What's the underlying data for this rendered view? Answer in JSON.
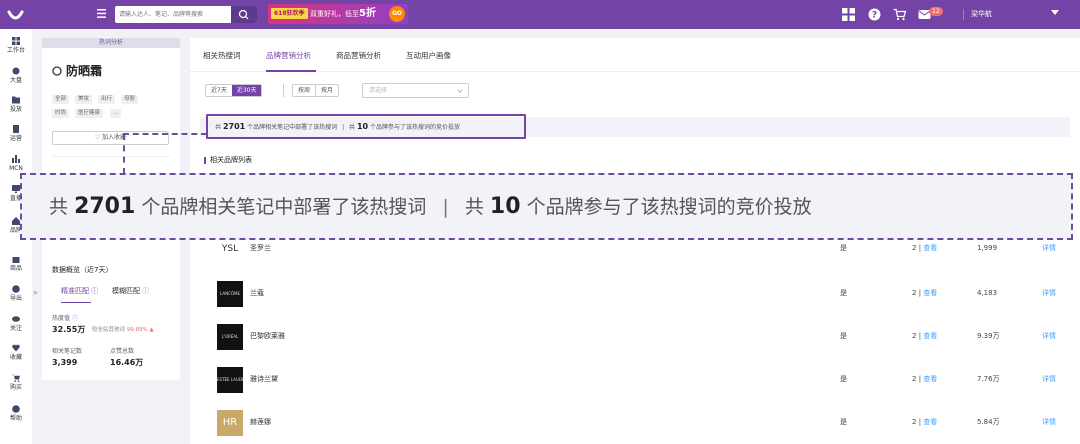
{
  "topbar": {
    "search_placeholder": "请输入达人、笔记、品牌等搜索",
    "promo_tag": "618狂欢季",
    "promo_text": "双重好礼，低至",
    "promo_highlight": "5折",
    "promo_go": "GO",
    "notify_count": "12",
    "user_name": "梁华航",
    "accent_color": "#7443a6"
  },
  "leftnav": [
    {
      "label": "工作台",
      "icon": "grid-icon"
    },
    {
      "label": "大盘",
      "icon": "globe-icon"
    },
    {
      "label": "投放",
      "icon": "folder-icon"
    },
    {
      "label": "运营",
      "icon": "document-icon"
    },
    {
      "label": "MCN",
      "icon": "chart-icon"
    },
    {
      "label": "直播",
      "icon": "monitor-icon"
    },
    {
      "label": "品牌",
      "icon": "home-icon"
    },
    {
      "label": "商品",
      "icon": "bag-icon"
    },
    {
      "label": "导出",
      "icon": "plus-circle-icon"
    },
    {
      "label": "关注",
      "icon": "eye-icon"
    },
    {
      "label": "收藏",
      "icon": "heart-icon"
    },
    {
      "label": "购买",
      "icon": "cart-icon"
    },
    {
      "label": "帮助",
      "icon": "question-icon"
    }
  ],
  "panel": {
    "header": "热词分析",
    "keyword": "防晒霜",
    "tags": [
      "全部",
      "美妆",
      "出行",
      "母婴",
      "时尚",
      "医疗健康",
      "..."
    ],
    "fav_label": "加入收藏",
    "stats_title": "数据概览（近7天）",
    "tab_exact": "精准匹配",
    "tab_fuzzy": "模糊匹配",
    "heat_label": "热度值",
    "heat_value": "32.55万",
    "heat_sub": "较全站其他词",
    "heat_pct": "99.89%",
    "notes_label": "相关笔记数",
    "notes_value": "3,399",
    "likes_label": "点赞总数",
    "likes_value": "16.46万",
    "collapse": "»"
  },
  "main": {
    "tabs": [
      "相关热搜词",
      "品牌营销分析",
      "商品营销分析",
      "互动用户画像"
    ],
    "range_7": "近7天",
    "range_30": "近30天",
    "by_week": "按周",
    "by_month": "按月",
    "select_placeholder": "请选择",
    "summary": {
      "prefix": "共",
      "brand_count": "2701",
      "mid": "个品牌相关笔记中部署了该热搜词",
      "sep": "|",
      "prefix2": "共",
      "bid_count": "10",
      "tail": "个品牌参与了该热搜词的竞价投放"
    },
    "list_title": "相关品牌列表",
    "view_label": "查看",
    "detail_label": "详情",
    "brands": [
      {
        "name": "圣罗兰",
        "logo": "YSL",
        "bid": "是",
        "notes": "2",
        "value": "1,999"
      },
      {
        "name": "兰蔻",
        "logo": "LANCÔME",
        "bid": "是",
        "notes": "2",
        "value": "4,183"
      },
      {
        "name": "巴黎欧莱雅",
        "logo": "L'ORÉAL",
        "bid": "是",
        "notes": "2",
        "value": "9.39万"
      },
      {
        "name": "雅诗兰黛",
        "logo": "ESTĒE LAUDER",
        "bid": "是",
        "notes": "2",
        "value": "7.76万"
      },
      {
        "name": "赫莲娜",
        "logo": "HR",
        "bid": "是",
        "notes": "2",
        "value": "5.84万"
      }
    ]
  }
}
